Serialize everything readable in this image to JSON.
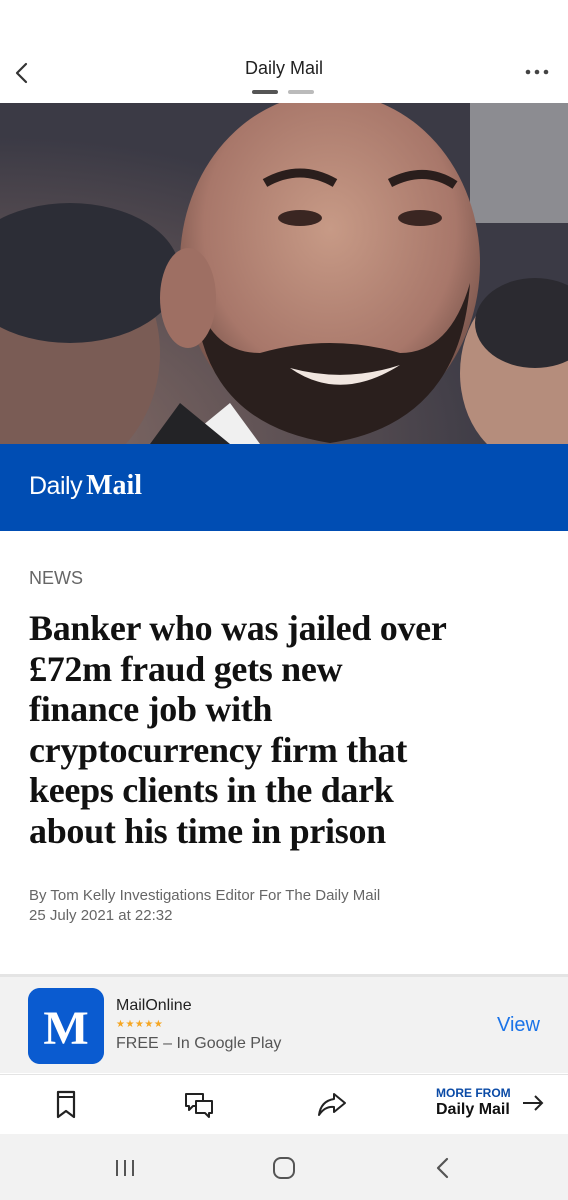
{
  "header": {
    "title": "Daily Mail",
    "back_icon": "chevron-left-icon",
    "menu_icon": "more-dots-icon"
  },
  "hero": {
    "image_description": "bearded man smiling"
  },
  "brand_bar": {
    "logo_daily": "Daily",
    "logo_mail": "Mail",
    "color": "#004db3"
  },
  "article": {
    "kicker": "NEWS",
    "headline_lines": [
      "Banker who was jailed over",
      "£72m fraud gets new",
      "finance job with",
      "cryptocurrency firm that",
      "keeps clients in the dark",
      "about his time in prison"
    ],
    "byline": "By Tom Kelly Investigations Editor For The Daily Mail",
    "date": "25 July 2021 at 22:32"
  },
  "app_banner": {
    "name": "MailOnline",
    "rating": "★★★★★",
    "subtitle": "FREE – In Google Play",
    "view_label": "View",
    "icon": "mail-app-icon"
  },
  "toolbar": {
    "icons": [
      "bookmark-icon",
      "comments-icon",
      "share-icon"
    ],
    "more_from_label": "MORE FROM",
    "more_from_name": "Daily Mail"
  },
  "system_nav": {
    "icons": [
      "recents-icon",
      "home-icon",
      "back-icon"
    ]
  }
}
